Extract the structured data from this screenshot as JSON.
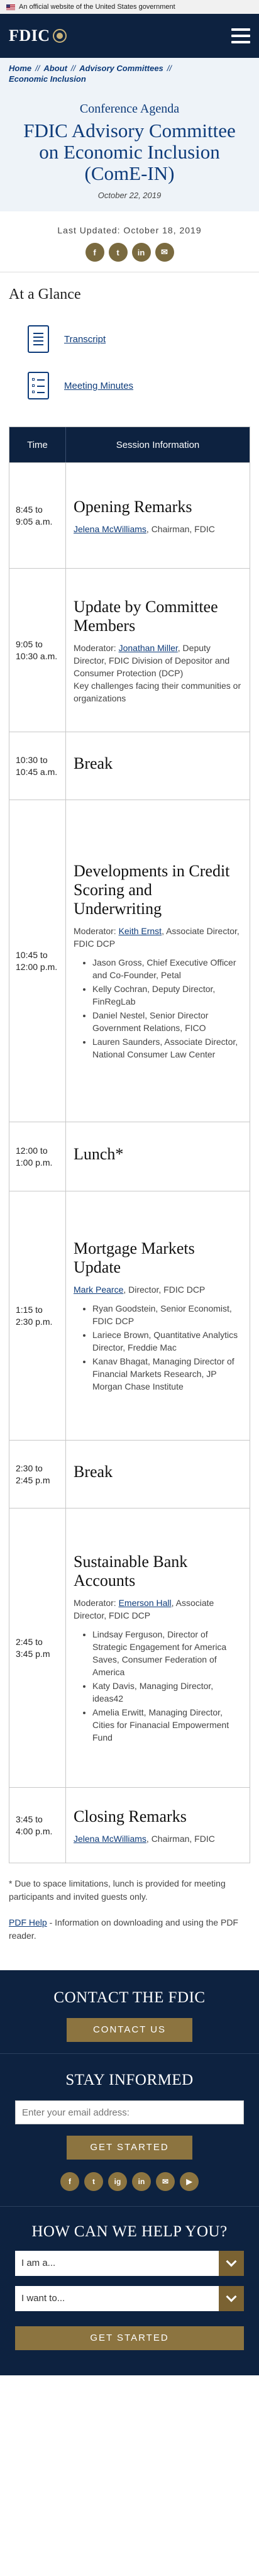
{
  "gov_banner": "An official website of the United States government",
  "logo_text": "FDIC",
  "breadcrumb": [
    "Home",
    "About",
    "Advisory Committees",
    "Economic Inclusion"
  ],
  "hero": {
    "kicker": "Conference Agenda",
    "title": "FDIC Advisory Committee on Economic Inclusion (ComE-IN)",
    "date": "October 22, 2019"
  },
  "last_updated": "Last Updated: October 18, 2019",
  "share_icons": [
    "f",
    "t",
    "in",
    "✉"
  ],
  "glance": {
    "heading": "At a Glance",
    "items": [
      {
        "label": "Transcript",
        "icon": "document-icon"
      },
      {
        "label": "Meeting Minutes",
        "icon": "list-icon"
      }
    ]
  },
  "agenda": {
    "col_time": "Time",
    "col_session": "Session Information",
    "rows": [
      {
        "time": "8:45 to 9:05 a.m.",
        "title": "Opening Remarks",
        "pre": "",
        "link": "Jelena McWilliams",
        "post": ", Chairman, FDIC",
        "bullets": []
      },
      {
        "time": "9:05 to 10:30 a.m.",
        "title": "Update by Committee Members",
        "pre": "Moderator: ",
        "link": "Jonathan Miller",
        "post": ", Deputy Director, FDIC Division of Depositor and Consumer Protection (DCP)",
        "extra": "Key challenges facing their communities or organizations",
        "bullets": []
      },
      {
        "time": "10:30 to 10:45 a.m.",
        "title": "Break",
        "pre": "",
        "link": "",
        "post": "",
        "bullets": []
      },
      {
        "time": "10:45 to 12:00 p.m.",
        "title": "Developments in Credit Scoring and Underwriting",
        "pre": "Moderator: ",
        "link": "Keith Ernst",
        "post": ", Associate Director, FDIC DCP",
        "bullets": [
          "Jason Gross, Chief Executive Officer and Co-Founder, Petal",
          "Kelly Cochran, Deputy Director, FinRegLab",
          "Daniel Nestel, Senior Director Government Relations, FICO",
          "Lauren Saunders, Associate Director, National Consumer Law Center"
        ]
      },
      {
        "time": "12:00 to 1:00 p.m.",
        "title": "Lunch*",
        "pre": "",
        "link": "",
        "post": "",
        "bullets": []
      },
      {
        "time": "1:15 to 2:30 p.m.",
        "title": "Mortgage Markets Update",
        "pre": "",
        "link": "Mark Pearce",
        "post": ", Director, FDIC DCP",
        "bullets": [
          "Ryan Goodstein, Senior Economist, FDIC DCP",
          "Lariece Brown, Quantitative Analytics Director, Freddie Mac",
          "Kanav Bhagat, Managing Director of Financial Markets Research, JP Morgan Chase Institute"
        ]
      },
      {
        "time": "2:30 to 2:45 p.m",
        "title": "Break",
        "pre": "",
        "link": "",
        "post": "",
        "bullets": []
      },
      {
        "time": "2:45 to 3:45 p.m",
        "title": "Sustainable Bank Accounts",
        "pre": "Moderator: ",
        "link": "Emerson Hall",
        "post": ", Associate Director, FDIC DCP",
        "bullets": [
          "Lindsay Ferguson, Director of Strategic Engagement for America Saves, Consumer Federation of America",
          "Katy Davis, Managing Director, ideas42",
          "Amelia Erwitt, Managing Director, Cities for Finanacial Empowerment Fund"
        ]
      },
      {
        "time": "3:45 to 4:00 p.m.",
        "title": "Closing Remarks",
        "pre": "",
        "link": "Jelena McWilliams",
        "post": ", Chairman, FDIC",
        "bullets": []
      }
    ]
  },
  "notes": {
    "lunch": "* Due to space limitations, lunch is provided for meeting participants and invited guests only.",
    "pdf_link": "PDF Help",
    "pdf_text": " - Information on downloading and using the PDF reader."
  },
  "footer": {
    "contact_heading": "CONTACT THE FDIC",
    "contact_button": "CONTACT US",
    "stay_heading": "STAY INFORMED",
    "email_placeholder": "Enter your email address:",
    "get_started": "GET STARTED",
    "social": [
      "f",
      "t",
      "ig",
      "in",
      "✉",
      "▶"
    ],
    "help_heading": "HOW CAN WE HELP YOU?",
    "select_1": "I am a...",
    "select_2": "I want to...",
    "help_button": "GET STARTED"
  }
}
